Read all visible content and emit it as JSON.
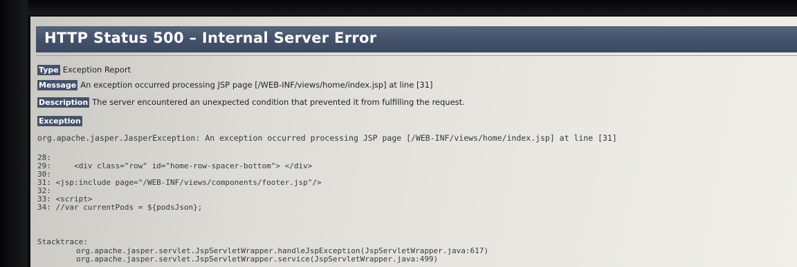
{
  "page": {
    "title": "HTTP Status 500 – Internal Server Error"
  },
  "report": {
    "type_label": "Type",
    "type_value": "Exception Report",
    "message_label": "Message",
    "message_value": "An exception occurred processing JSP page [/WEB-INF/views/home/index.jsp] at line [31]",
    "description_label": "Description",
    "description_value": "The server encountered an unexpected condition that prevented it from fulfilling the request.",
    "exception_label": "Exception",
    "exception_value": "org.apache.jasper.JasperException: An exception occurred processing JSP page [/WEB-INF/views/home/index.jsp] at line [31]"
  },
  "source_lines": [
    "28:",
    "29:     <div class=\"row\" id=\"home-row-spacer-bottom\"> </div>",
    "30:",
    "31: <jsp:include page=\"/WEB-INF/views/components/footer.jsp\"/>",
    "32:",
    "33: <script>",
    "34: //var currentPods = ${podsJson};"
  ],
  "stacktrace": {
    "label": "Stacktrace:",
    "frames": [
      "org.apache.jasper.servlet.JspServletWrapper.handleJspException(JspServletWrapper.java:617)",
      "org.apache.jasper.servlet.JspServletWrapper.service(JspServletWrapper.java:499)"
    ]
  },
  "colors": {
    "title_bar": "#45516a",
    "label_bg": "#45516a",
    "page_bg": "#e6e5df"
  }
}
